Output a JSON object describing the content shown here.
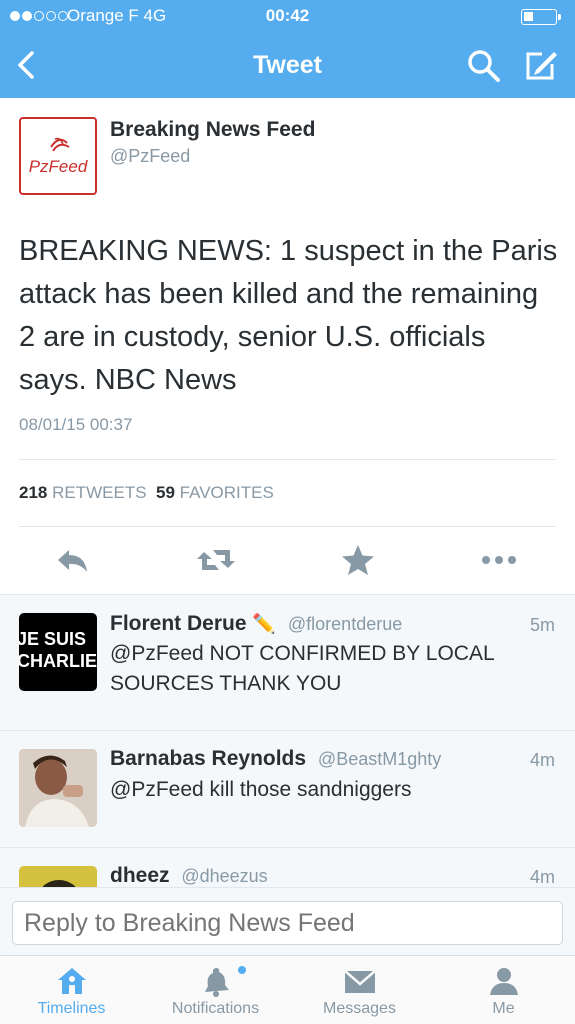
{
  "status_bar": {
    "carrier": "Orange F  4G",
    "time": "00:42"
  },
  "nav": {
    "title": "Tweet",
    "back_icon": "chevron-left-icon",
    "search_icon": "search-icon",
    "compose_icon": "compose-icon"
  },
  "tweet": {
    "author_name": "Breaking News Feed",
    "author_handle": "@PzFeed",
    "avatar_text": "PzFeed",
    "text": "BREAKING NEWS: 1 suspect in the Paris attack has been killed and the remaining 2 are in custody, senior U.S. officials says. NBC News",
    "timestamp": "08/01/15 00:37",
    "retweet_count": "218",
    "retweet_label": "RETWEETS",
    "favorite_count": "59",
    "favorite_label": "FAVORITES"
  },
  "replies": [
    {
      "name": "Florent Derue",
      "badge": "✏️",
      "handle": "@florentderue",
      "time": "5m",
      "text": "@PzFeed NOT CONFIRMED BY LOCAL SOURCES THANK YOU",
      "avatar_line1": "JE SUIS",
      "avatar_line2": "CHARLIE"
    },
    {
      "name": "Barnabas Reynolds",
      "handle": "@BeastM1ghty",
      "time": "4m",
      "text": "@PzFeed kill those sandniggers"
    },
    {
      "name": "dheez",
      "handle": "@dheezus",
      "time": "4m",
      "text": ""
    }
  ],
  "reply_box": {
    "placeholder": "Reply to Breaking News Feed"
  },
  "tabs": [
    {
      "label": "Timelines",
      "icon": "home-icon",
      "active": true
    },
    {
      "label": "Notifications",
      "icon": "bell-icon",
      "active": false
    },
    {
      "label": "Messages",
      "icon": "envelope-icon",
      "active": false
    },
    {
      "label": "Me",
      "icon": "person-icon",
      "active": false
    }
  ],
  "colors": {
    "brand": "#55acee",
    "text": "#292f33",
    "muted": "#8899a6",
    "pz_red": "#c9302c"
  }
}
